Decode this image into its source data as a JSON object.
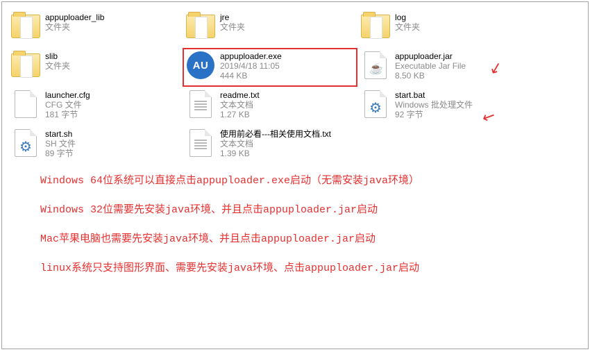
{
  "files": [
    {
      "name": "appuploader_lib",
      "meta1": "文件夹",
      "meta2": ""
    },
    {
      "name": "jre",
      "meta1": "文件夹",
      "meta2": ""
    },
    {
      "name": "log",
      "meta1": "文件夹",
      "meta2": ""
    },
    {
      "name": "slib",
      "meta1": "文件夹",
      "meta2": ""
    },
    {
      "name": "appuploader.exe",
      "meta1": "2019/4/18 11:05",
      "meta2": "444 KB"
    },
    {
      "name": "appuploader.jar",
      "meta1": "Executable Jar File",
      "meta2": "8.50 KB"
    },
    {
      "name": "launcher.cfg",
      "meta1": "CFG 文件",
      "meta2": "181 字节"
    },
    {
      "name": "readme.txt",
      "meta1": "文本文档",
      "meta2": "1.27 KB"
    },
    {
      "name": "start.bat",
      "meta1": "Windows 批处理文件",
      "meta2": "92 字节"
    },
    {
      "name": "start.sh",
      "meta1": "SH 文件",
      "meta2": "89 字节"
    },
    {
      "name": "使用前必看---相关使用文档.txt",
      "meta1": "文本文档",
      "meta2": "1.39 KB"
    }
  ],
  "au_label": "AU",
  "notes": {
    "line1": "Windows 64位系统可以直接点击appuploader.exe启动（无需安装java环境）",
    "line2": "Windows 32位需要先安装java环境、并且点击appuploader.jar启动",
    "line3": "Mac苹果电脑也需要先安装java环境、并且点击appuploader.jar启动",
    "line4": "linux系统只支持图形界面、需要先安装java环境、点击appuploader.jar启动"
  }
}
